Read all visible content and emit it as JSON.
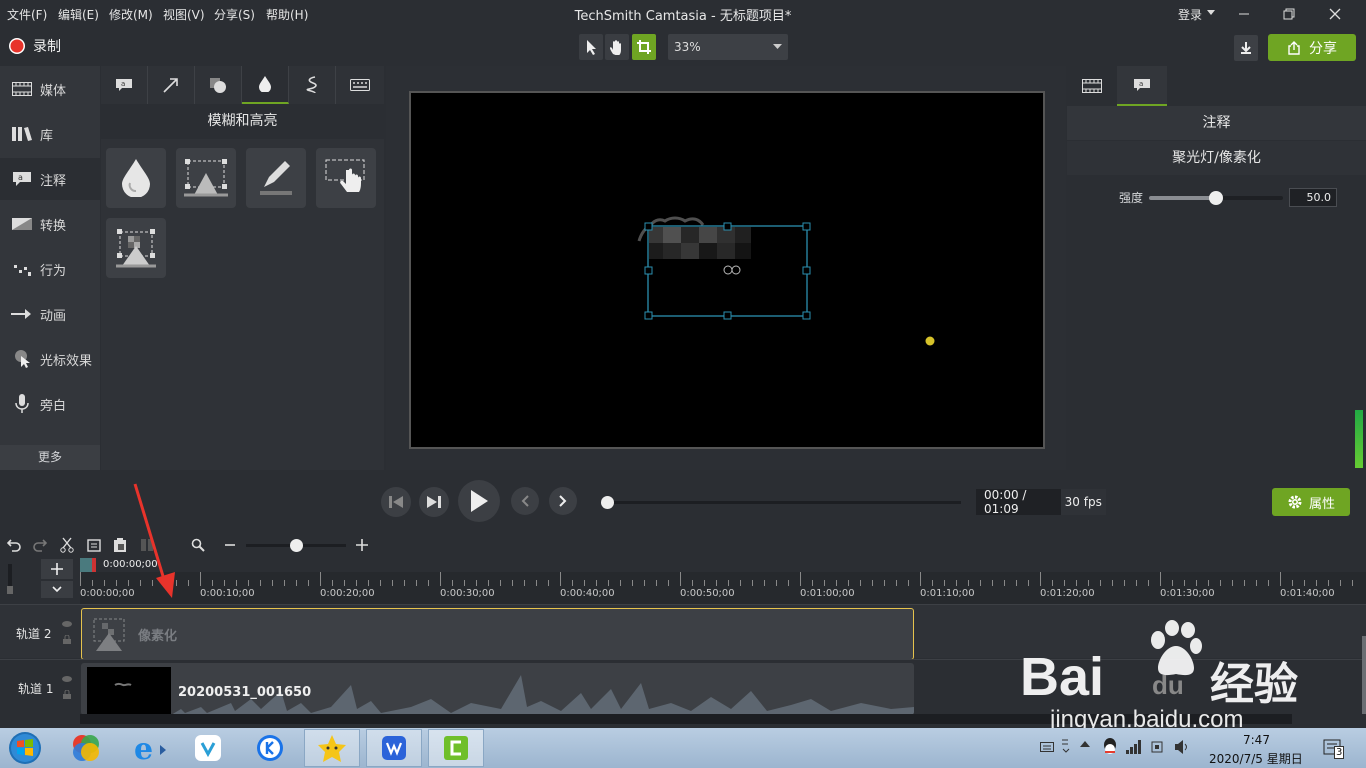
{
  "menubar": {
    "items": [
      "文件(F)",
      "编辑(E)",
      "修改(M)",
      "视图(V)",
      "分享(S)",
      "帮助(H)"
    ],
    "title": "TechSmith Camtasia - 无标题项目*",
    "login": "登录"
  },
  "toolbar": {
    "record_label": "录制",
    "zoom": "33%",
    "share_label": "分享"
  },
  "nav": {
    "items": [
      {
        "label": "媒体",
        "icon": "film-icon"
      },
      {
        "label": "库",
        "icon": "library-icon"
      },
      {
        "label": "注释",
        "icon": "annotation-icon"
      },
      {
        "label": "转换",
        "icon": "transition-icon"
      },
      {
        "label": "行为",
        "icon": "behavior-icon"
      },
      {
        "label": "动画",
        "icon": "animation-icon"
      },
      {
        "label": "光标效果",
        "icon": "cursor-effect-icon"
      },
      {
        "label": "旁白",
        "icon": "microphone-icon"
      }
    ],
    "more": "更多"
  },
  "panel": {
    "heading": "模糊和高亮"
  },
  "right_panel": {
    "title": "注释",
    "subtitle": "聚光灯/像素化",
    "intensity_label": "强度",
    "intensity_value": "50.0",
    "intensity_fraction": 0.5
  },
  "transport": {
    "time": "00:00 / 01:09",
    "fps": "30 fps",
    "properties_label": "属性"
  },
  "timeline": {
    "playhead_time": "0:00:00;00",
    "ticks": [
      "0:00:00;00",
      "0:00:10;00",
      "0:00:20;00",
      "0:00:30;00",
      "0:00:40;00",
      "0:00:50;00",
      "0:01:00;00",
      "0:01:10;00",
      "0:01:20;00",
      "0:01:30;00",
      "0:01:40;00"
    ],
    "tracks": [
      {
        "name": "轨道 2",
        "clip": "像素化"
      },
      {
        "name": "轨道 1",
        "clip": "20200531_001650"
      }
    ]
  },
  "watermark": {
    "brand": "Bai",
    "brand2": "du",
    "suffix": "经验",
    "url": "jingyan.baidu.com"
  },
  "taskbar": {
    "time": "7:47",
    "date": "2020/7/5 星期日",
    "notification_count": "3"
  },
  "colors": {
    "accent_green": "#6fa523",
    "record_red": "#e8332b",
    "selection_blue": "#2b8fb0",
    "clip_border": "#e6c34d"
  }
}
